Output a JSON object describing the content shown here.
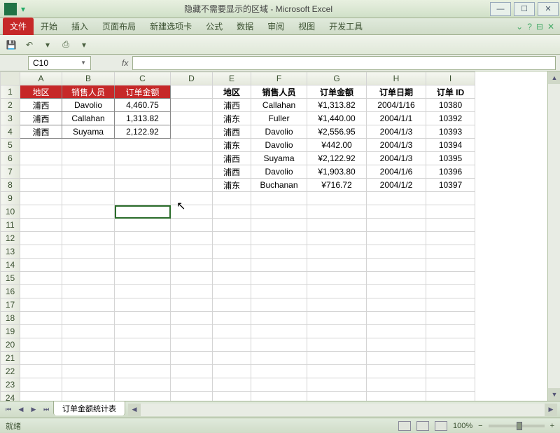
{
  "window": {
    "title": "隐藏不需要显示的区域 - Microsoft Excel"
  },
  "ribbon": {
    "tabs": [
      "文件",
      "开始",
      "插入",
      "页面布局",
      "新建选项卡",
      "公式",
      "数据",
      "审阅",
      "视图",
      "开发工具"
    ]
  },
  "namebox": {
    "value": "C10"
  },
  "formula": {
    "fx": "fx"
  },
  "columns": [
    "A",
    "B",
    "C",
    "D",
    "E",
    "F",
    "G",
    "H",
    "I"
  ],
  "left_table": {
    "headers": [
      "地区",
      "销售人员",
      "订单金额"
    ],
    "rows": [
      [
        "浦西",
        "Davolio",
        "4,460.75"
      ],
      [
        "浦西",
        "Callahan",
        "1,313.82"
      ],
      [
        "浦西",
        "Suyama",
        "2,122.92"
      ]
    ]
  },
  "right_table": {
    "headers": [
      "地区",
      "销售人员",
      "订单金额",
      "订单日期",
      "订单 ID"
    ],
    "rows": [
      [
        "浦西",
        "Callahan",
        "¥1,313.82",
        "2004/1/16",
        "10380"
      ],
      [
        "浦东",
        "Fuller",
        "¥1,440.00",
        "2004/1/1",
        "10392"
      ],
      [
        "浦西",
        "Davolio",
        "¥2,556.95",
        "2004/1/3",
        "10393"
      ],
      [
        "浦东",
        "Davolio",
        "¥442.00",
        "2004/1/3",
        "10394"
      ],
      [
        "浦西",
        "Suyama",
        "¥2,122.92",
        "2004/1/3",
        "10395"
      ],
      [
        "浦西",
        "Davolio",
        "¥1,903.80",
        "2004/1/6",
        "10396"
      ],
      [
        "浦东",
        "Buchanan",
        "¥716.72",
        "2004/1/2",
        "10397"
      ]
    ]
  },
  "sheet_tab": "订单金额统计表",
  "status": {
    "label": "就绪",
    "zoom": "100%"
  },
  "zoom": {
    "minus": "−",
    "plus": "+"
  },
  "rownums": [
    "1",
    "2",
    "3",
    "4",
    "5",
    "6",
    "7",
    "8",
    "9",
    "10",
    "11",
    "12",
    "13",
    "14",
    "15",
    "16",
    "17",
    "18",
    "19",
    "20",
    "21",
    "22",
    "23",
    "24"
  ]
}
